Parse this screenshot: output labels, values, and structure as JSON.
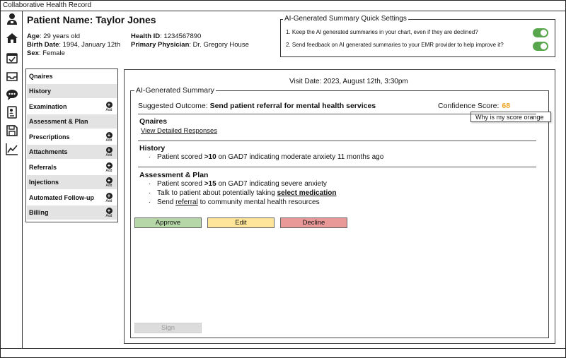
{
  "app": {
    "title": "Collaborative Health Record"
  },
  "rail": {
    "icons": [
      "doctor-profile-icon",
      "home-icon",
      "calendar-check-icon",
      "inbox-icon",
      "chat-icon",
      "contact-card-icon",
      "save-icon",
      "analytics-icon"
    ]
  },
  "patient": {
    "name_label": "Patient Name:",
    "name": "Taylor Jones",
    "age_label": "Age",
    "age": ": 29 years old",
    "birth_label": "Birth Date",
    "birth": ": 1994, January 12th",
    "sex_label": "Sex",
    "sex": ": Female",
    "health_id_label": "Health ID",
    "health_id": ": 1234567890",
    "physician_label": "Primary Physician",
    "physician": ": Dr. Gregory House"
  },
  "quick_settings": {
    "title": "AI-Generated Summary Quick Settings",
    "items": [
      {
        "text": "1. Keep the AI generated summaries in your chart, even if they are declined?",
        "on": true
      },
      {
        "text": "2. Send feedback on AI generated summaries to your EMR provider to help improve it?",
        "on": true
      }
    ],
    "toggle_color": "#5aa64e"
  },
  "sections": {
    "add_label": "Add",
    "items": [
      {
        "label": "Qnaires",
        "add": false
      },
      {
        "label": "History",
        "add": false
      },
      {
        "label": "Examination",
        "add": true
      },
      {
        "label": "Assessment & Plan",
        "add": false
      },
      {
        "label": "Prescriptions",
        "add": true
      },
      {
        "label": "Attachments",
        "add": true
      },
      {
        "label": "Referrals",
        "add": true
      },
      {
        "label": "Injections",
        "add": true
      },
      {
        "label": "Automated Follow-up",
        "add": true
      },
      {
        "label": "Billing",
        "add": true
      }
    ]
  },
  "main": {
    "visit_date": "Visit Date: 2023, August 12th, 3:30pm",
    "summary_title": "AI-Generated Summary",
    "suggested_label": "Suggested Outcome: ",
    "suggested_value": "Send patient referral for mental health services",
    "confidence_label": "Confidence Score:",
    "confidence_score": "68",
    "confidence_color": "#f0a020",
    "tooltip": "Why is my score orange",
    "qnaires_heading": "Qnaires",
    "qnaires_link": "View Detailed Responses",
    "history_heading": "History",
    "history_bullet": {
      "pre": "Patient scored ",
      "bold": ">10",
      "post": " on GAD7 indicating moderate anxiety 11 months ago"
    },
    "plan_heading": "Assessment & Plan",
    "plan_bullets": {
      "b1_pre": "Patient scored ",
      "b1_bold": ">15",
      "b1_post": " on GAD7 indicating severe anxiety",
      "b2_pre": "Talk to patient about potentially taking ",
      "b2_link": "select medication",
      "b3_pre": "Send ",
      "b3_link": "referral",
      "b3_post": " to community mental health resources"
    },
    "buttons": {
      "approve": "Approve",
      "edit": "Edit",
      "decline": "Decline",
      "sign": "Sign"
    },
    "button_colors": {
      "approve": "#b6d7a8",
      "edit": "#ffe599",
      "decline": "#ea9999"
    }
  }
}
